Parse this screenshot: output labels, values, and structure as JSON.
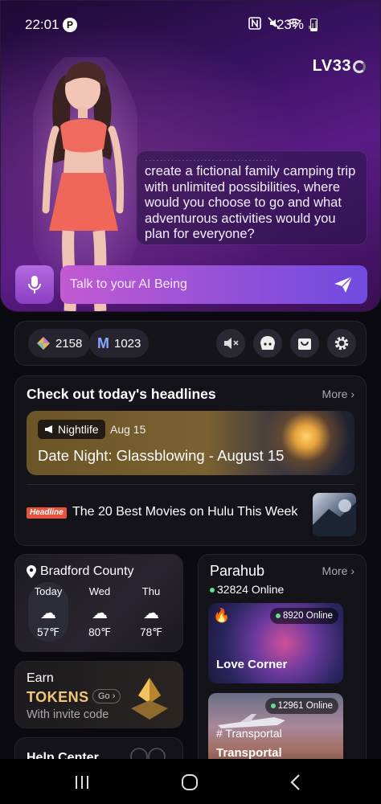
{
  "status_bar": {
    "time": "22:01",
    "p_badge": "P",
    "battery": "23%"
  },
  "level": {
    "label": "LV33"
  },
  "chat": {
    "message": "create a fictional family camping trip with unlimited possibilities, where would you choose to go and what adventurous activities would you plan for everyone?",
    "input_placeholder": "Talk to your AI Being"
  },
  "stats": {
    "gems": "2158",
    "m_coins": "1023",
    "m_letter": "M"
  },
  "headlines": {
    "title": "Check out today's headlines",
    "more": "More",
    "featured": {
      "tag": "Nightlife",
      "date": "Aug 15",
      "title": "Date Night: Glassblowing - August 15"
    },
    "item": {
      "badge": "Headline",
      "text": "The 20 Best Movies on Hulu This Week"
    }
  },
  "weather": {
    "location": "Bradford County",
    "days": [
      {
        "day": "Today",
        "temp": "57℉"
      },
      {
        "day": "Wed",
        "temp": "80℉"
      },
      {
        "day": "Thu",
        "temp": "78℉"
      }
    ]
  },
  "tokens": {
    "earn": "Earn",
    "tokens": "TOKENS",
    "go": "Go",
    "subtitle": "With invite code"
  },
  "help": {
    "title": "Help Center"
  },
  "parahub": {
    "title": "Parahub",
    "more": "More",
    "online": "32824 Online",
    "rooms": [
      {
        "online": "8920 Online",
        "name": "Love Corner",
        "tag": ""
      },
      {
        "online": "12961 Online",
        "name": "Transportal",
        "tag": "# Transportal"
      }
    ]
  },
  "colors": {
    "accent": "#8f50d8",
    "gold": "#f2c874",
    "online": "#5fe08a",
    "headline_badge": "#e8543a"
  }
}
